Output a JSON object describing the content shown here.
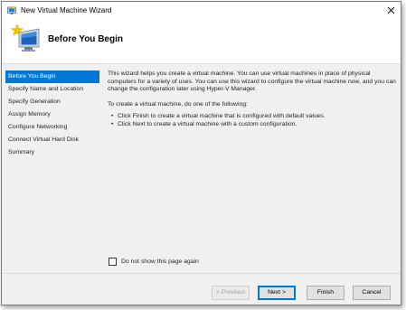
{
  "window": {
    "title": "New Virtual Machine Wizard",
    "close_label": "✕"
  },
  "header": {
    "title": "Before You Begin"
  },
  "steps": [
    {
      "label": "Before You Begin",
      "active": true
    },
    {
      "label": "Specify Name and Location",
      "active": false
    },
    {
      "label": "Specify Generation",
      "active": false
    },
    {
      "label": "Assign Memory",
      "active": false
    },
    {
      "label": "Configure Networking",
      "active": false
    },
    {
      "label": "Connect Virtual Hard Disk",
      "active": false
    },
    {
      "label": "Summary",
      "active": false
    }
  ],
  "content": {
    "intro": "This wizard helps you create a virtual machine. You can use virtual machines in place of physical computers for a variety of uses. You can use this wizard to configure the virtual machine now, and you can change the configuration later using Hyper-V Manager.",
    "prompt": "To create a virtual machine, do one of the following:",
    "options": [
      "Click Finish to create a virtual machine that is configured with default values.",
      "Click Next to create a virtual machine with a custom configuration."
    ]
  },
  "checkbox": {
    "label": "Do not show this page again",
    "checked": false
  },
  "buttons": {
    "previous": "< Previous",
    "next": "Next >",
    "finish": "Finish",
    "cancel": "Cancel"
  },
  "colors": {
    "accent": "#0078d7"
  },
  "icons": {
    "title": "hyper-v-wizard-icon",
    "header": "new-vm-monitor-icon"
  }
}
